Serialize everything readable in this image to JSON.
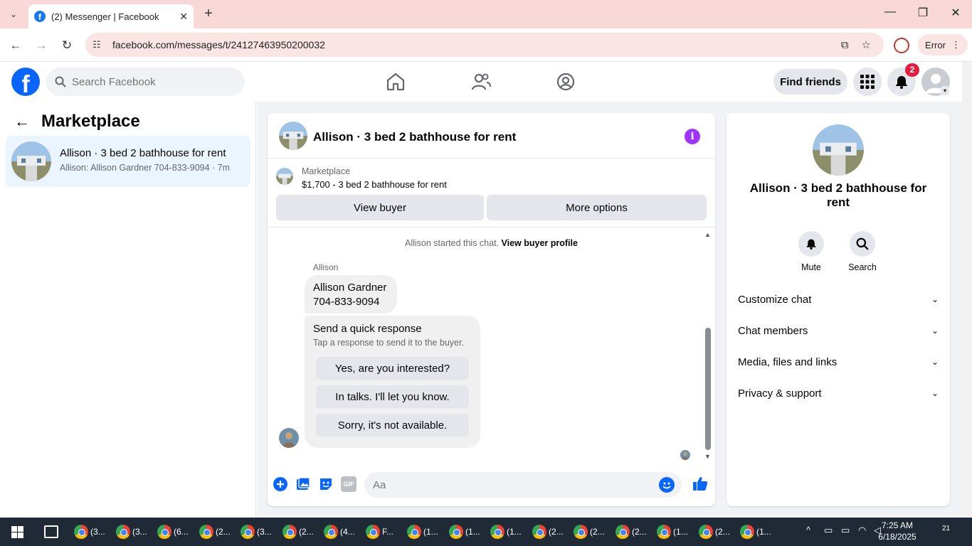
{
  "browser": {
    "tab_title": "(2) Messenger | Facebook",
    "url": "facebook.com/messages/t/24127463950200032",
    "error_label": "Error"
  },
  "fb_header": {
    "search_placeholder": "Search Facebook",
    "find_friends": "Find friends",
    "notification_count": "2"
  },
  "left_panel": {
    "title": "Marketplace",
    "conversations": [
      {
        "name": "Allison · 3 bed 2 bathhouse for rent",
        "preview": "Allison: Allison Gardner 704-833-9094 · 7m"
      }
    ]
  },
  "chat": {
    "header_name": "Allison · 3 bed 2 bathhouse for rent",
    "marketplace_label": "Marketplace",
    "listing": "$1,700 - 3 bed 2 bathhouse for rent",
    "view_buyer": "View buyer",
    "more_options": "More options",
    "started_text": "Allison started this chat.",
    "view_buyer_profile": "View buyer profile",
    "sender": "Allison",
    "message_line1": "Allison Gardner",
    "message_line2": "704-833-9094",
    "quick_title": "Send a quick response",
    "quick_sub": "Tap a response to send it to the buyer.",
    "quick_responses": [
      "Yes, are you interested?",
      "In talks. I'll let you know.",
      "Sorry, it's not available."
    ],
    "composer_placeholder": "Aa",
    "gif_label": "GIF"
  },
  "right_panel": {
    "name": "Allison · 3 bed 2 bathhouse for rent",
    "mute": "Mute",
    "search": "Search",
    "sections": [
      "Customize chat",
      "Chat members",
      "Media, files and links",
      "Privacy & support"
    ]
  },
  "taskbar": {
    "apps": [
      "(3...",
      "(3...",
      "(6...",
      "(2...",
      "(3...",
      "(2...",
      "(4...",
      "F...",
      "(1...",
      "(1...",
      "(1...",
      "(2...",
      "(2...",
      "(2...",
      "(1...",
      "(2...",
      "(1..."
    ],
    "time": "7:25 AM",
    "date": "6/18/2025",
    "notif_count": "21"
  },
  "colors": {
    "fb_blue": "#0866ff",
    "accent_purple": "#a033ff",
    "badge_red": "#e41e3f",
    "selected_conv": "#ebf5ff"
  }
}
